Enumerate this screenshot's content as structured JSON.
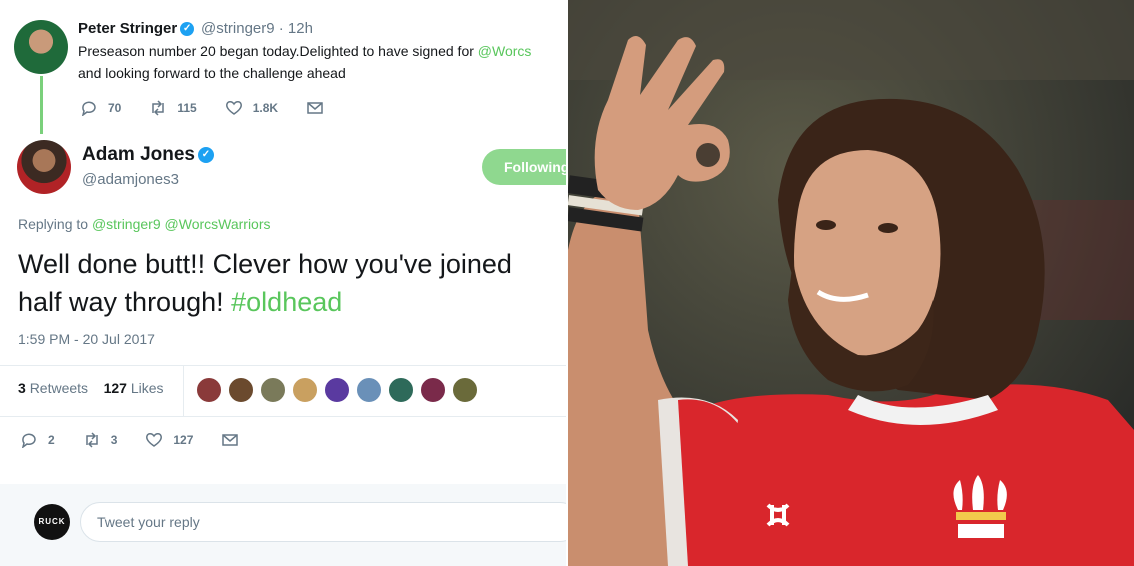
{
  "parent_tweet": {
    "author_name": "Peter Stringer",
    "handle": "@stringer9",
    "time_ago": "· 12h",
    "text_before": "Preseason number 20 began today.Delighted to have signed for ",
    "mention": "@Worcs",
    "text_after": " and looking forward to the challenge ahead",
    "reply_count": "70",
    "retweet_count": "115",
    "like_count": "1.8K"
  },
  "main_tweet": {
    "author_name": "Adam Jones",
    "handle": "@adamjones3",
    "follow_label": "Following",
    "replying_label": "Replying to",
    "replying_to_1": "@stringer9",
    "replying_to_2": "@WorcsWarriors",
    "line1": "Well done butt!! Clever how you've joined",
    "line2_text": "half way through! ",
    "hashtag": "#oldhead",
    "timestamp": "1:59 PM - 20 Jul 2017",
    "retweets_num": "3",
    "retweets_label": "Retweets",
    "likes_num": "127",
    "likes_label": "Likes",
    "reply_count": "2",
    "retweet_count": "3",
    "like_count": "127"
  },
  "reply_box": {
    "logo_text": "RUCK",
    "placeholder": "Tweet your reply"
  },
  "colors": {
    "accent_green": "#59c65c",
    "verified_blue": "#1da1f2",
    "jersey_red": "#d9262c"
  },
  "icons": [
    "reply-icon",
    "retweet-icon",
    "like-icon",
    "message-icon",
    "verified-icon"
  ]
}
